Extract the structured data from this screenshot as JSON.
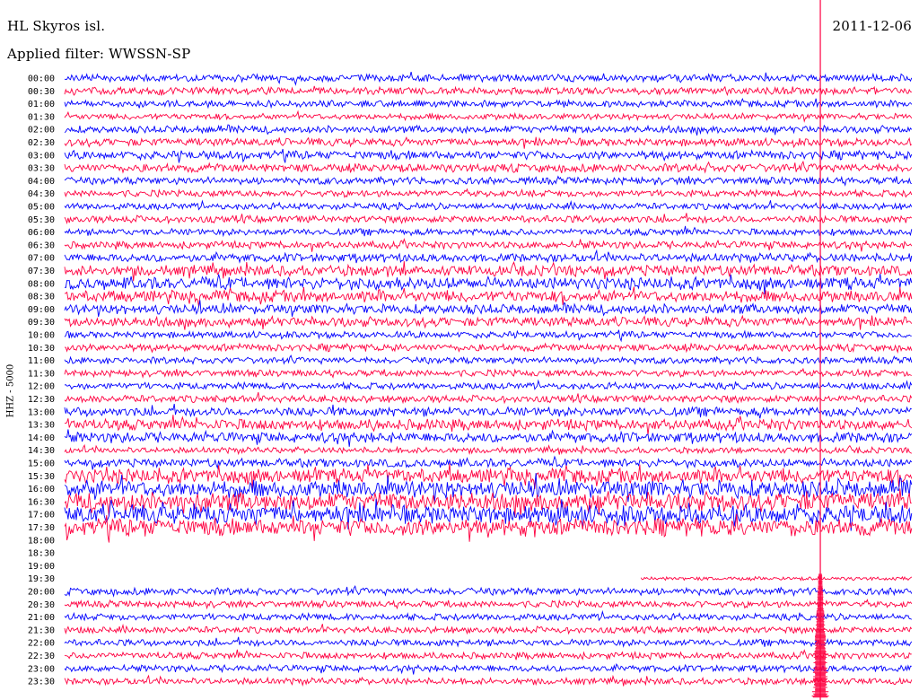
{
  "header": {
    "station": "HL Skyros isl.",
    "date": "2011-12-06",
    "filter": "Applied filter: WWSSN-SP"
  },
  "chart_data": {
    "type": "helicorder",
    "title": "HL Skyros isl.",
    "date": "2011-12-06",
    "ylabel": "HHZ - 5000",
    "rows": [
      "00:00",
      "00:30",
      "01:00",
      "01:30",
      "02:00",
      "02:30",
      "03:00",
      "03:30",
      "04:00",
      "04:30",
      "05:00",
      "05:30",
      "06:00",
      "06:30",
      "07:00",
      "07:30",
      "08:00",
      "08:30",
      "09:00",
      "09:30",
      "10:00",
      "10:30",
      "11:00",
      "11:30",
      "12:00",
      "12:30",
      "13:00",
      "13:30",
      "14:00",
      "14:30",
      "15:00",
      "15:30",
      "16:00",
      "16:30",
      "17:00",
      "17:30",
      "18:00",
      "18:30",
      "19:00",
      "19:30",
      "20:00",
      "20:30",
      "21:00",
      "21:30",
      "22:00",
      "22:30",
      "23:00",
      "23:30"
    ],
    "colors": {
      "even": "#0000ff",
      "odd": "#ff0040",
      "marker": "#ff0040"
    },
    "relative_amplitude": [
      0.6,
      0.6,
      0.55,
      0.5,
      0.6,
      0.65,
      0.7,
      0.7,
      0.6,
      0.55,
      0.55,
      0.6,
      0.55,
      0.6,
      0.7,
      0.9,
      1.0,
      0.95,
      0.8,
      0.8,
      0.55,
      0.6,
      0.55,
      0.55,
      0.55,
      0.6,
      0.75,
      0.9,
      0.85,
      0.5,
      0.7,
      1.2,
      1.4,
      1.5,
      1.5,
      1.4,
      0.0,
      0.0,
      0.0,
      0.3,
      0.6,
      0.55,
      0.55,
      0.55,
      0.55,
      0.55,
      0.55,
      0.55
    ],
    "gaps": [
      {
        "row": "18:00",
        "from": 0.0,
        "to": 1.0
      },
      {
        "row": "18:30",
        "from": 0.0,
        "to": 1.0
      },
      {
        "row": "19:00",
        "from": 0.0,
        "to": 1.0
      },
      {
        "row": "19:30",
        "from": 0.0,
        "to": 0.68
      }
    ],
    "event_marker": {
      "time_fraction": 0.892,
      "row_start": "00:00",
      "row_end": "23:30"
    }
  }
}
